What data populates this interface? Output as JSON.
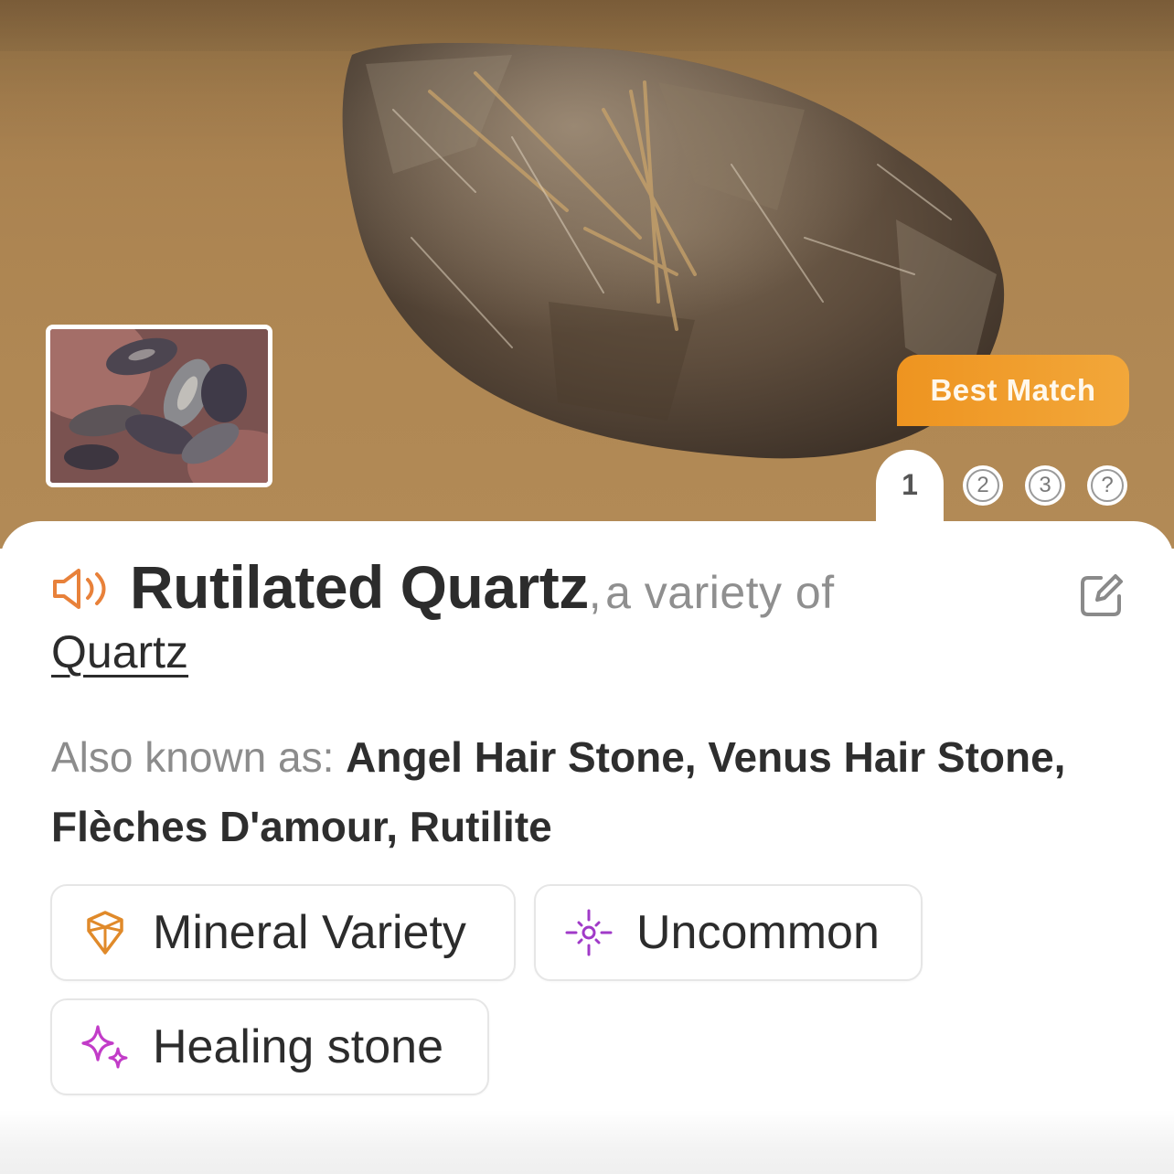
{
  "hero": {
    "badge_label": "Best Match",
    "pager": {
      "active": "1",
      "others": [
        "2",
        "3",
        "?"
      ]
    }
  },
  "result": {
    "name": "Rutilated Quartz",
    "separator": ",",
    "variety_prefix": "a variety of",
    "parent": "Quartz",
    "aka_label": "Also known as:",
    "aka_value": "Angel Hair Stone, Venus Hair Stone, Flèches D'amour, Rutilite"
  },
  "chips": [
    {
      "label": "Mineral Variety",
      "icon": "gem-outline-icon",
      "color": "#e08a2a"
    },
    {
      "label": "Uncommon",
      "icon": "sparkle-burst-icon",
      "color": "#a03ac8"
    },
    {
      "label": "Healing stone",
      "icon": "sparkles-icon",
      "color": "#c23cc8"
    }
  ],
  "colors": {
    "accent_orange": "#ee9420",
    "speaker_icon": "#e8813a",
    "text_dark": "#2c2c2c",
    "text_muted": "#8c8c8c"
  }
}
